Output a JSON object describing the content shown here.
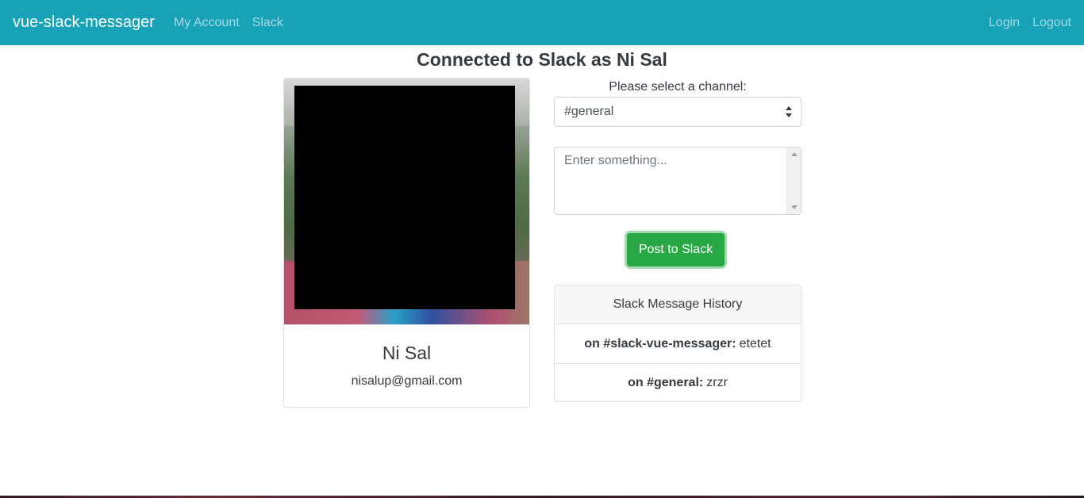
{
  "nav": {
    "brand": "vue-slack-messager",
    "links": [
      "My Account",
      "Slack"
    ],
    "right_links": [
      "Login",
      "Logout"
    ]
  },
  "page": {
    "title": "Connected to Slack as Ni Sal"
  },
  "profile": {
    "name": "Ni Sal",
    "email": "nisalup@gmail.com"
  },
  "form": {
    "channel_label": "Please select a channel:",
    "selected_channel": "#general",
    "message_placeholder": "Enter something...",
    "post_label": "Post to Slack"
  },
  "history": {
    "header": "Slack Message History",
    "items": [
      {
        "channel": "on #slack-vue-messager:",
        "text": "etetet"
      },
      {
        "channel": "on #general:",
        "text": "zrzr"
      }
    ]
  },
  "colors": {
    "navbar": "#17a2b8",
    "post_button": "#28a745"
  }
}
